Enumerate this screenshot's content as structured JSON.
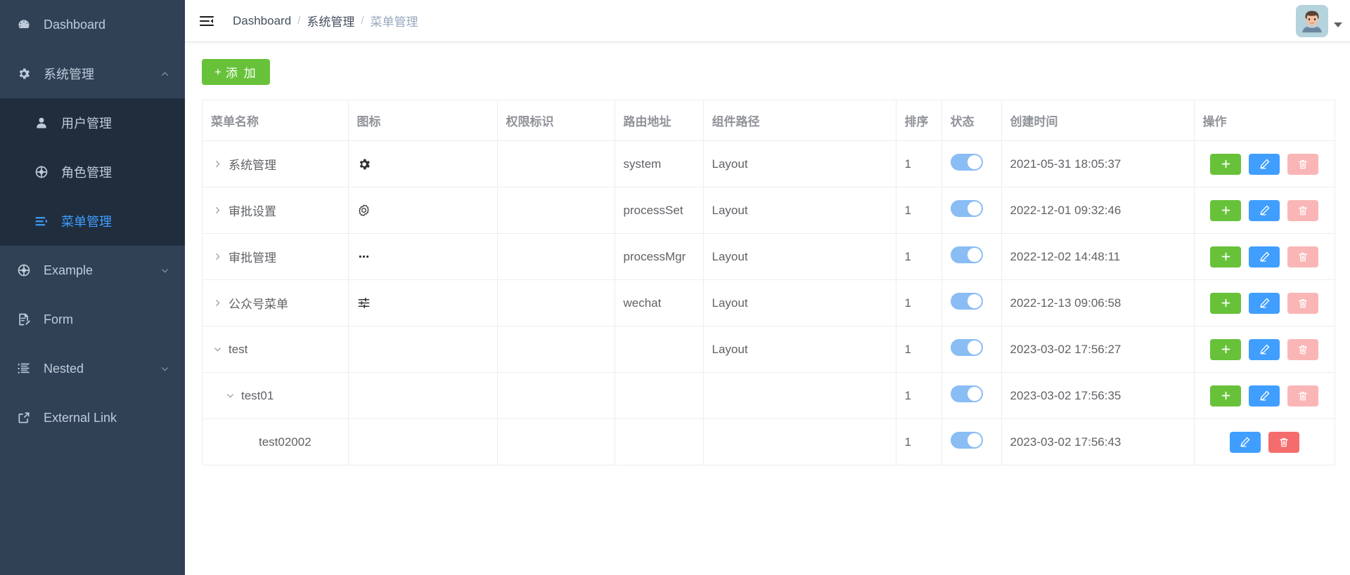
{
  "sidebar": {
    "items": [
      {
        "label": "Dashboard",
        "icon": "dashboard-icon",
        "level": "top",
        "arrow": "none",
        "active": false
      },
      {
        "label": "系统管理",
        "icon": "gear-icon",
        "level": "top",
        "arrow": "up",
        "active": false
      },
      {
        "label": "用户管理",
        "icon": "user-icon",
        "level": "sub",
        "arrow": "none",
        "active": false
      },
      {
        "label": "角色管理",
        "icon": "compass-icon",
        "level": "sub",
        "arrow": "none",
        "active": false
      },
      {
        "label": "菜单管理",
        "icon": "list-icon",
        "level": "sub",
        "arrow": "none",
        "active": true
      },
      {
        "label": "Example",
        "icon": "compass-icon",
        "level": "top",
        "arrow": "down",
        "active": false
      },
      {
        "label": "Form",
        "icon": "form-icon",
        "level": "top",
        "arrow": "none",
        "active": false
      },
      {
        "label": "Nested",
        "icon": "nested-icon",
        "level": "top",
        "arrow": "down",
        "active": false
      },
      {
        "label": "External Link",
        "icon": "external-link-icon",
        "level": "top",
        "arrow": "none",
        "active": false
      }
    ]
  },
  "navbar": {
    "hamburger_icon": "hamburger-icon",
    "breadcrumb": [
      {
        "label": "Dashboard",
        "muted": false
      },
      {
        "label": "系统管理",
        "muted": false
      },
      {
        "label": "菜单管理",
        "muted": true
      }
    ],
    "separator": "/",
    "avatar_icon": "user-avatar",
    "caret_icon": "caret-down-icon"
  },
  "toolbar": {
    "add_label": "添 加",
    "add_plus": "+"
  },
  "table": {
    "columns": [
      {
        "key": "name",
        "label": "菜单名称"
      },
      {
        "key": "icon",
        "label": "图标"
      },
      {
        "key": "perm",
        "label": "权限标识"
      },
      {
        "key": "route",
        "label": "路由地址"
      },
      {
        "key": "component",
        "label": "组件路径"
      },
      {
        "key": "sort",
        "label": "排序"
      },
      {
        "key": "status",
        "label": "状态"
      },
      {
        "key": "created",
        "label": "创建时间"
      },
      {
        "key": "ops",
        "label": "操作"
      }
    ],
    "rows": [
      {
        "name": "系统管理",
        "depth": 0,
        "arrow": "right",
        "icon": "gear-icon",
        "perm": "",
        "route": "system",
        "component": "Layout",
        "sort": "1",
        "status_on": true,
        "created": "2021-05-31 18:05:37",
        "ops": [
          "add",
          "edit",
          "delete-disabled"
        ]
      },
      {
        "name": "审批设置",
        "depth": 0,
        "arrow": "right",
        "icon": "setting-outline-icon",
        "perm": "",
        "route": "processSet",
        "component": "Layout",
        "sort": "1",
        "status_on": true,
        "created": "2022-12-01 09:32:46",
        "ops": [
          "add",
          "edit",
          "delete-disabled"
        ]
      },
      {
        "name": "审批管理",
        "depth": 0,
        "arrow": "right",
        "icon": "more-dots-icon",
        "perm": "",
        "route": "processMgr",
        "component": "Layout",
        "sort": "1",
        "status_on": true,
        "created": "2022-12-02 14:48:11",
        "ops": [
          "add",
          "edit",
          "delete-disabled"
        ]
      },
      {
        "name": "公众号菜单",
        "depth": 0,
        "arrow": "right",
        "icon": "sliders-icon",
        "perm": "",
        "route": "wechat",
        "component": "Layout",
        "sort": "1",
        "status_on": true,
        "created": "2022-12-13 09:06:58",
        "ops": [
          "add",
          "edit",
          "delete-disabled"
        ]
      },
      {
        "name": "test",
        "depth": 0,
        "arrow": "down",
        "icon": "",
        "perm": "",
        "route": "",
        "component": "Layout",
        "sort": "1",
        "status_on": true,
        "created": "2023-03-02 17:56:27",
        "ops": [
          "add",
          "edit",
          "delete-disabled"
        ]
      },
      {
        "name": "test01",
        "depth": 1,
        "arrow": "down",
        "icon": "",
        "perm": "",
        "route": "",
        "component": "",
        "sort": "1",
        "status_on": true,
        "created": "2023-03-02 17:56:35",
        "ops": [
          "add",
          "edit",
          "delete-disabled"
        ]
      },
      {
        "name": "test02002",
        "depth": 2,
        "arrow": "none",
        "icon": "",
        "perm": "",
        "route": "",
        "component": "",
        "sort": "1",
        "status_on": true,
        "created": "2023-03-02 17:56:43",
        "ops": [
          "edit",
          "delete"
        ]
      }
    ]
  },
  "colors": {
    "sidebar_bg": "#304156",
    "submenu_bg": "#1f2d3d",
    "accent_blue": "#409eff",
    "success_green": "#67c23a",
    "danger_red": "#f56c6c",
    "danger_red_soft": "#fab6b6",
    "switch_on": "#89bdf4"
  }
}
